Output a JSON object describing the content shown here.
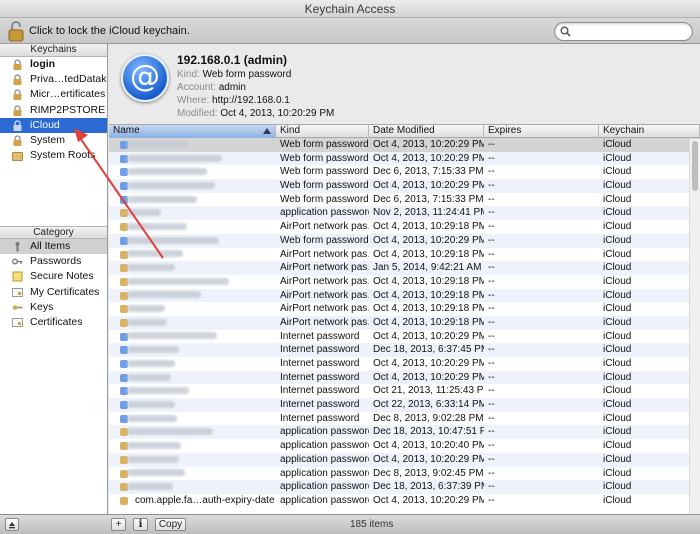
{
  "window": {
    "title": "Keychain Access"
  },
  "toolbar": {
    "lock_text": "Click to lock the iCloud keychain.",
    "search_placeholder": ""
  },
  "sidebar": {
    "keychains_header": "Keychains",
    "keychains": [
      {
        "label": "login",
        "bold": true,
        "icon": "lock-icon"
      },
      {
        "label": "Priva…tedDatak",
        "icon": "lock-icon"
      },
      {
        "label": "Micr…ertificates",
        "icon": "lock-icon"
      },
      {
        "label": "RIMP2PSTORE",
        "icon": "lock-icon"
      },
      {
        "label": "iCloud",
        "selected": true,
        "icon": "cloud-lock-icon"
      },
      {
        "label": "System",
        "icon": "lock-icon"
      },
      {
        "label": "System Roots",
        "icon": "folder-icon"
      }
    ],
    "category_header": "Category",
    "categories": [
      {
        "label": "All Items",
        "selected": true,
        "icon": "all-items-icon"
      },
      {
        "label": "Passwords",
        "icon": "password-icon"
      },
      {
        "label": "Secure Notes",
        "icon": "note-icon"
      },
      {
        "label": "My Certificates",
        "icon": "certificate-icon"
      },
      {
        "label": "Keys",
        "icon": "key-icon"
      },
      {
        "label": "Certificates",
        "icon": "certificate-icon"
      }
    ]
  },
  "detail": {
    "title": "192.168.0.1 (admin)",
    "kind_label": "Kind:",
    "kind": "Web form password",
    "account_label": "Account:",
    "account": "admin",
    "where_label": "Where:",
    "where": "http://192.168.0.1",
    "modified_label": "Modified:",
    "modified": "Oct 4, 2013, 10:20:29 PM"
  },
  "table": {
    "columns": [
      "Name",
      "Kind",
      "Date Modified",
      "Expires",
      "Keychain"
    ],
    "rows": [
      {
        "kind": "Web form password",
        "date": "Oct 4, 2013, 10:20:29 PM",
        "expires": "--",
        "keychain": "iCloud",
        "selected": true
      },
      {
        "kind": "Web form password",
        "date": "Oct 4, 2013, 10:20:29 PM",
        "expires": "--",
        "keychain": "iCloud"
      },
      {
        "kind": "Web form password",
        "date": "Dec 6, 2013, 7:15:33 PM",
        "expires": "--",
        "keychain": "iCloud"
      },
      {
        "kind": "Web form password",
        "date": "Oct 4, 2013, 10:20:29 PM",
        "expires": "--",
        "keychain": "iCloud"
      },
      {
        "kind": "Web form password",
        "date": "Dec 6, 2013, 7:15:33 PM",
        "expires": "--",
        "keychain": "iCloud"
      },
      {
        "kind": "application password",
        "date": "Nov 2, 2013, 11:24:41 PM",
        "expires": "--",
        "keychain": "iCloud"
      },
      {
        "kind": "AirPort network pas…",
        "date": "Oct 4, 2013, 10:29:18 PM",
        "expires": "--",
        "keychain": "iCloud"
      },
      {
        "kind": "Web form password",
        "date": "Oct 4, 2013, 10:20:29 PM",
        "expires": "--",
        "keychain": "iCloud"
      },
      {
        "kind": "AirPort network pas…",
        "date": "Oct 4, 2013, 10:29:18 PM",
        "expires": "--",
        "keychain": "iCloud"
      },
      {
        "kind": "AirPort network pas…",
        "date": "Jan 5, 2014, 9:42:21 AM",
        "expires": "--",
        "keychain": "iCloud"
      },
      {
        "kind": "AirPort network pas…",
        "date": "Oct 4, 2013, 10:29:18 PM",
        "expires": "--",
        "keychain": "iCloud"
      },
      {
        "kind": "AirPort network pas…",
        "date": "Oct 4, 2013, 10:29:18 PM",
        "expires": "--",
        "keychain": "iCloud"
      },
      {
        "kind": "AirPort network pas…",
        "date": "Oct 4, 2013, 10:29:18 PM",
        "expires": "--",
        "keychain": "iCloud"
      },
      {
        "kind": "AirPort network pas…",
        "date": "Oct 4, 2013, 10:29:18 PM",
        "expires": "--",
        "keychain": "iCloud"
      },
      {
        "kind": "Internet password",
        "date": "Oct 4, 2013, 10:20:29 PM",
        "expires": "--",
        "keychain": "iCloud"
      },
      {
        "kind": "Internet password",
        "date": "Dec 18, 2013, 6:37:45 PM",
        "expires": "--",
        "keychain": "iCloud"
      },
      {
        "kind": "Internet password",
        "date": "Oct 4, 2013, 10:20:29 PM",
        "expires": "--",
        "keychain": "iCloud"
      },
      {
        "kind": "Internet password",
        "date": "Oct 4, 2013, 10:20:29 PM",
        "expires": "--",
        "keychain": "iCloud"
      },
      {
        "kind": "Internet password",
        "date": "Oct 21, 2013, 11:25:43 PM",
        "expires": "--",
        "keychain": "iCloud"
      },
      {
        "kind": "Internet password",
        "date": "Oct 22, 2013, 6:33:14 PM",
        "expires": "--",
        "keychain": "iCloud"
      },
      {
        "kind": "Internet password",
        "date": "Dec 8, 2013, 9:02:28 PM",
        "expires": "--",
        "keychain": "iCloud"
      },
      {
        "kind": "application password",
        "date": "Dec 18, 2013, 10:47:51 PM",
        "expires": "--",
        "keychain": "iCloud"
      },
      {
        "kind": "application password",
        "date": "Oct 4, 2013, 10:20:40 PM",
        "expires": "--",
        "keychain": "iCloud"
      },
      {
        "kind": "application password",
        "date": "Oct 4, 2013, 10:20:29 PM",
        "expires": "--",
        "keychain": "iCloud"
      },
      {
        "kind": "application password",
        "date": "Dec 8, 2013, 9:02:45 PM",
        "expires": "--",
        "keychain": "iCloud"
      },
      {
        "kind": "application password",
        "date": "Dec 18, 2013, 6:37:39 PM",
        "expires": "--",
        "keychain": "iCloud"
      },
      {
        "name": "com.apple.fa…auth-expiry-date",
        "kind": "application password",
        "date": "Oct 4, 2013, 10:20:29 PM",
        "expires": "--",
        "keychain": "iCloud"
      }
    ]
  },
  "bottombar": {
    "add_label": "+",
    "info_label": "i",
    "copy_label": "Copy",
    "count": "185 items"
  },
  "colors": {
    "selection": "#2a6ad2",
    "annotation": "#e0403a"
  }
}
